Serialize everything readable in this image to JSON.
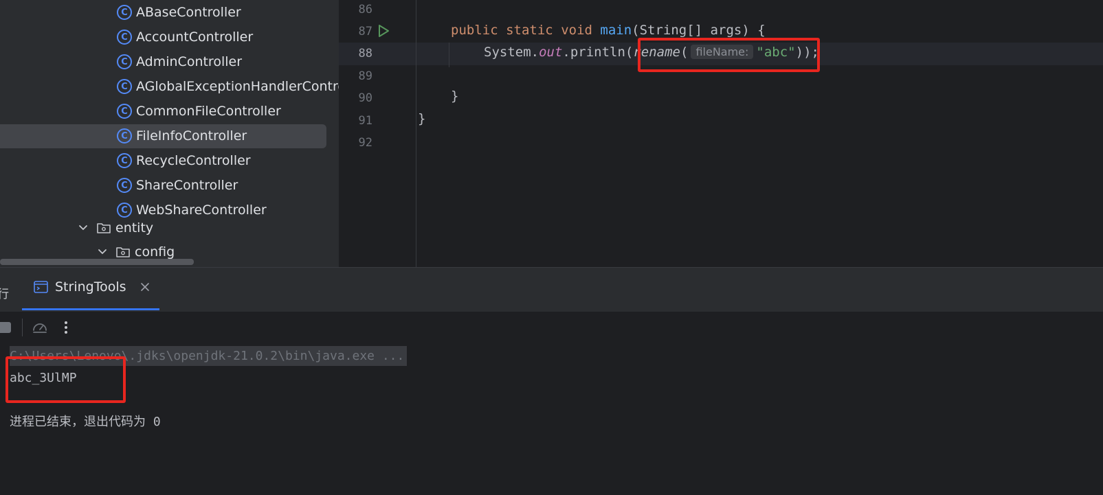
{
  "project_tree": {
    "classes": [
      {
        "name": "ABaseController",
        "selected": false
      },
      {
        "name": "AccountController",
        "selected": false
      },
      {
        "name": "AdminController",
        "selected": false
      },
      {
        "name": "AGlobalExceptionHandlerContro",
        "selected": false
      },
      {
        "name": "CommonFileController",
        "selected": false
      },
      {
        "name": "FileInfoController",
        "selected": true
      },
      {
        "name": "RecycleController",
        "selected": false
      },
      {
        "name": "ShareController",
        "selected": false
      },
      {
        "name": "WebShareController",
        "selected": false
      }
    ],
    "class_icon_glyph": "C",
    "folders": [
      {
        "name": "entity"
      },
      {
        "name": "config"
      }
    ]
  },
  "editor": {
    "line_numbers": [
      "86",
      "87",
      "88",
      "89",
      "90",
      "91",
      "92"
    ],
    "active_line": "88",
    "line87": {
      "kw1": "public",
      "kw2": "static",
      "kw3": "void",
      "method": "main",
      "params": "(String[] args) {"
    },
    "line88": {
      "receiver": "System.",
      "field": "out",
      "call": ".println(",
      "method": "rename",
      "open_paren": "(",
      "param_hint": "fileName:",
      "argument": "\"abc\"",
      "close": "));"
    },
    "line90": "}",
    "line91": "}"
  },
  "run_panel": {
    "prev_tab_glyph": "行",
    "tab_label": "StringTools",
    "console": {
      "command": "C:\\Users\\Lenovo\\.jdks\\openjdk-21.0.2\\bin\\java.exe ...",
      "output": "abc_3UlMP",
      "exit_message": "进程已结束，退出代码为 0"
    }
  },
  "colors": {
    "accent": "#3574f0",
    "annotation": "#e8261f",
    "keyword": "#cf8e6d",
    "method": "#56a8f5",
    "string": "#6aab73",
    "field": "#c77dbb"
  }
}
